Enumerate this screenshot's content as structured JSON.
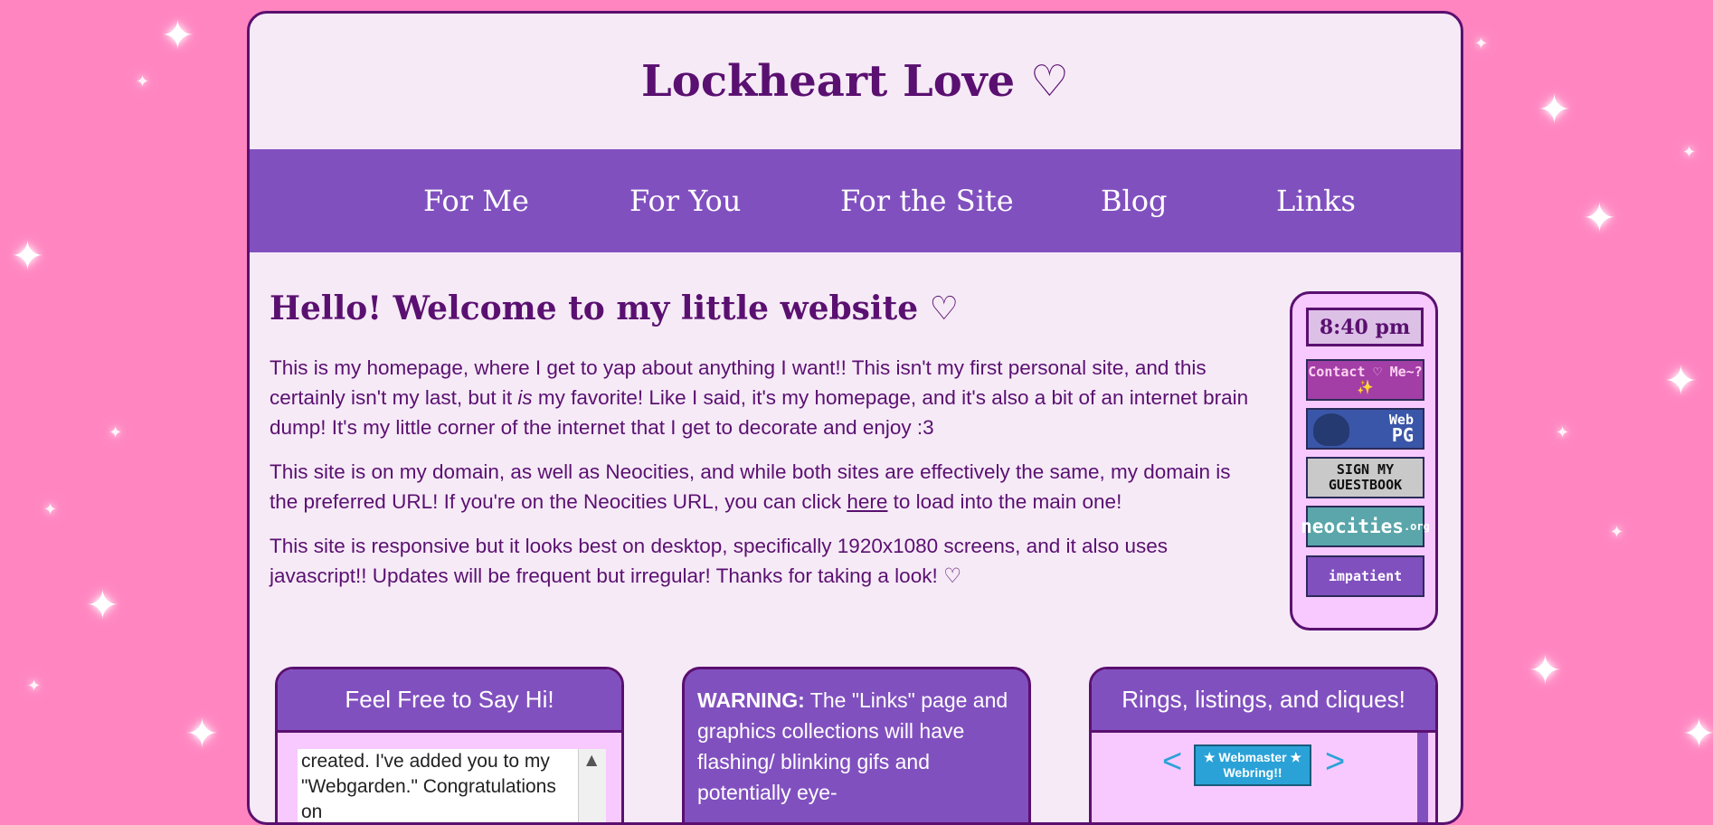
{
  "site": {
    "title": "Lockheart Love ♡"
  },
  "nav": {
    "items": [
      "For Me",
      "For You",
      "For the Site",
      "Blog",
      "Links"
    ]
  },
  "main": {
    "heading": "Hello! Welcome to my little website ♡",
    "para1_a": "This is my homepage, where I get to yap about anything I want!! This isn't my first personal site, and this certainly isn't my last, but it ",
    "para1_em": "is",
    "para1_b": " my favorite! Like I said, it's my homepage, and it's also a bit of an internet brain dump! It's my little corner of the internet that I get to decorate and enjoy :3",
    "para2_a": "This site is on my domain, as well as Neocities, and while both sites are effectively the same, my domain is the preferred URL! If you're on the Neocities URL, you can click ",
    "para2_link": "here",
    "para2_b": " to load into the main one!",
    "para3": "This site is responsive but it looks best on desktop, specifically 1920x1080 screens, and it also uses javascript!! Updates will be frequent but irregular! Thanks for taking a look! ♡"
  },
  "sidebar": {
    "clock": "8:40 pm",
    "buttons": {
      "contact": "Contact ♡ Me~? ✨",
      "webpg_label1": "Web",
      "webpg_label2": "PG",
      "guestbook": "SIGN MY GUESTBOOK",
      "neocities": "neocities",
      "neocities_org": ".org",
      "impatient": "impatient"
    }
  },
  "cards": {
    "say_hi": {
      "title": "Feel Free to Say Hi!",
      "text": "created. I've added you to my \"Webgarden.\" Congratulations on"
    },
    "warning": {
      "label": "WARNING:",
      "text": " The \"Links\" page and graphics collections will have flashing/ blinking gifs and potentially eye-"
    },
    "rings": {
      "title": "Rings, listings, and cliques!",
      "prev": "<",
      "next": ">",
      "webring": "★ Webmaster ★ Webring!!"
    }
  },
  "colors": {
    "background": "#ff85c0",
    "panel": "#f6eaf7",
    "nav": "#8150bf",
    "text": "#5a1070"
  }
}
